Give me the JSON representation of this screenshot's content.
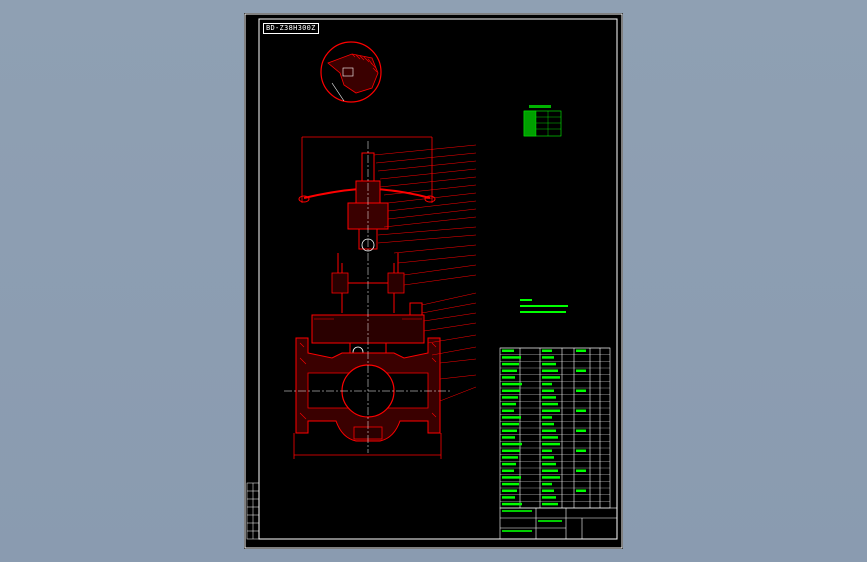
{
  "drawing": {
    "code_label": "BD-Z38H300Z",
    "line_colors": {
      "frame": "#ffffff",
      "inner_frame": "#ff0000",
      "hatch": "#ff0000",
      "body": "#ff0000",
      "centerline": "#ffffff",
      "annotation": "#00ff00"
    },
    "parts_list_rows": 24,
    "background": "#000000",
    "viewport_background": "#8f9fb2"
  }
}
